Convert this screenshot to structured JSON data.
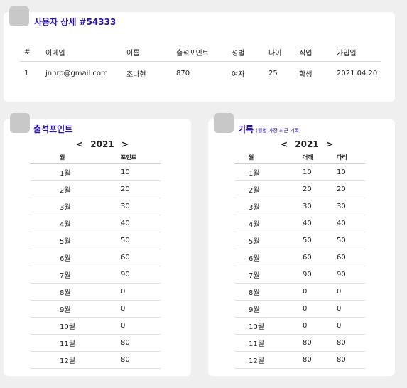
{
  "user_detail": {
    "title": "사용자 상세 #54333",
    "columns": [
      "#",
      "이메일",
      "이름",
      "출석포인트",
      "성별",
      "나이",
      "직업",
      "가입일"
    ],
    "row": [
      "1",
      "jnhro@gmail.com",
      "조나현",
      "870",
      "여자",
      "25",
      "학생",
      "2021.04.20"
    ]
  },
  "attendance": {
    "title": "출석포인트",
    "year": "2021",
    "prev_label": "<",
    "next_label": ">",
    "columns": [
      "월",
      "포인트"
    ],
    "rows": [
      [
        "1월",
        "10"
      ],
      [
        "2월",
        "20"
      ],
      [
        "3월",
        "30"
      ],
      [
        "4월",
        "40"
      ],
      [
        "5월",
        "50"
      ],
      [
        "6월",
        "60"
      ],
      [
        "7월",
        "90"
      ],
      [
        "8월",
        "0"
      ],
      [
        "9월",
        "0"
      ],
      [
        "10월",
        "0"
      ],
      [
        "11월",
        "80"
      ],
      [
        "12월",
        "80"
      ]
    ]
  },
  "records": {
    "title": "기록",
    "subtitle": "(월별 가장 최근 기록)",
    "year": "2021",
    "prev_label": "<",
    "next_label": ">",
    "columns": [
      "월",
      "어깨",
      "다리"
    ],
    "rows": [
      [
        "1월",
        "10",
        "10"
      ],
      [
        "2월",
        "20",
        "20"
      ],
      [
        "3월",
        "30",
        "30"
      ],
      [
        "4월",
        "40",
        "40"
      ],
      [
        "5월",
        "50",
        "50"
      ],
      [
        "6월",
        "60",
        "60"
      ],
      [
        "7월",
        "90",
        "90"
      ],
      [
        "8월",
        "0",
        "0"
      ],
      [
        "9월",
        "0",
        "0"
      ],
      [
        "10월",
        "0",
        "0"
      ],
      [
        "11월",
        "80",
        "80"
      ],
      [
        "12월",
        "80",
        "80"
      ]
    ]
  }
}
